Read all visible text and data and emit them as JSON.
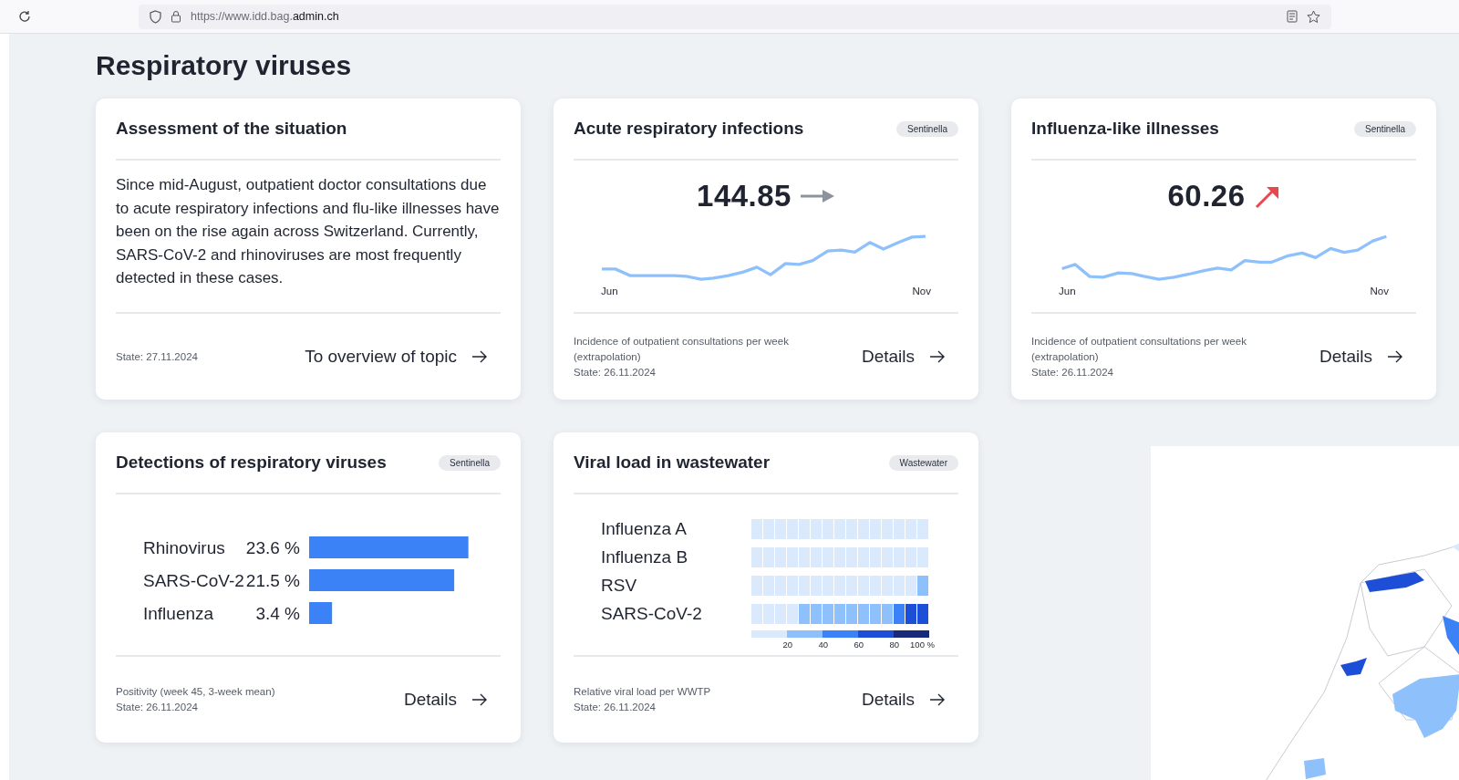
{
  "browser": {
    "url": "https://www.idd.bag.**admin.ch**"
  },
  "heading": "Respiratory viruses",
  "cards": [
    {
      "kind": "text",
      "title": "Assessment of the situation",
      "text": "Since mid-August, outpatient doctor consultations due to acute respiratory infections and flu-like illnesses have been on the rise again across Switzerland. Currently, SARS-CoV-2 and rhinoviruses are most frequently detected in these cases.",
      "state": "State: 27.11.2024",
      "link": "To overview of topic"
    },
    {
      "kind": "trend",
      "title": "Acute respiratory infections",
      "badge": "Sentinella",
      "value": "144.85",
      "trend": {
        "kind": "flat"
      },
      "start_label": "Jun",
      "end_label": "Nov",
      "note": "Incidence of outpatient consultations per week (extrapolation)",
      "state": "State: 26.11.2024",
      "link": "Details"
    },
    {
      "kind": "trend",
      "title": "Influenza-like illnesses",
      "badge": "Sentinella",
      "value": "60.26",
      "trend": {
        "kind": "up"
      },
      "start_label": "Jun",
      "end_label": "Nov",
      "note": "Incidence of outpatient consultations per week (extrapolation)",
      "state": "State: 26.11.2024",
      "link": "Details"
    },
    {
      "kind": "bars",
      "title": "Detections of respiratory viruses",
      "badge": "Sentinella",
      "chart_data": {
        "type": "bar",
        "orientation": "horizontal",
        "categories": [
          "Rhinovirus",
          "SARS-CoV-2",
          "Influenza"
        ],
        "values": [
          23.6,
          21.5,
          3.4
        ],
        "value_labels": [
          "23.6 %",
          "21.5 %",
          "3.4 %"
        ]
      },
      "note": "Positivity (week 45, 3-week mean)",
      "state": "State: 26.11.2024",
      "link": "Details"
    },
    {
      "kind": "heatmap",
      "title": "Viral load in wastewater",
      "badge": "Wastewater",
      "rows": [
        {
          "name": "Influenza A",
          "cells": [
            {
              "color": "#dbe9fd"
            },
            {
              "color": "#dbe9fd"
            },
            {
              "color": "#dbe9fd"
            },
            {
              "color": "#dbe9fd"
            },
            {
              "color": "#dbe9fd"
            },
            {
              "color": "#dbe9fd"
            },
            {
              "color": "#dbe9fd"
            },
            {
              "color": "#dbe9fd"
            },
            {
              "color": "#dbe9fd"
            },
            {
              "color": "#dbe9fd"
            },
            {
              "color": "#dbe9fd"
            },
            {
              "color": "#dbe9fd"
            },
            {
              "color": "#dbe9fd"
            },
            {
              "color": "#dbe9fd"
            },
            {
              "color": "#dbe9fd"
            }
          ]
        },
        {
          "name": "Influenza B",
          "cells": [
            {
              "color": "#dbe9fd"
            },
            {
              "color": "#dbe9fd"
            },
            {
              "color": "#dbe9fd"
            },
            {
              "color": "#dbe9fd"
            },
            {
              "color": "#dbe9fd"
            },
            {
              "color": "#dbe9fd"
            },
            {
              "color": "#dbe9fd"
            },
            {
              "color": "#dbe9fd"
            },
            {
              "color": "#dbe9fd"
            },
            {
              "color": "#dbe9fd"
            },
            {
              "color": "#dbe9fd"
            },
            {
              "color": "#dbe9fd"
            },
            {
              "color": "#dbe9fd"
            },
            {
              "color": "#dbe9fd"
            },
            {
              "color": "#dbe9fd"
            }
          ]
        },
        {
          "name": "RSV",
          "cells": [
            {
              "color": "#dbe9fd"
            },
            {
              "color": "#dbe9fd"
            },
            {
              "color": "#dbe9fd"
            },
            {
              "color": "#dbe9fd"
            },
            {
              "color": "#dbe9fd"
            },
            {
              "color": "#dbe9fd"
            },
            {
              "color": "#dbe9fd"
            },
            {
              "color": "#dbe9fd"
            },
            {
              "color": "#dbe9fd"
            },
            {
              "color": "#dbe9fd"
            },
            {
              "color": "#dbe9fd"
            },
            {
              "color": "#dbe9fd"
            },
            {
              "color": "#dbe9fd"
            },
            {
              "color": "#dbe9fd"
            },
            {
              "color": "#8ec1fb"
            }
          ]
        },
        {
          "name": "SARS-CoV-2",
          "cells": [
            {
              "color": "#dbe9fd"
            },
            {
              "color": "#dbe9fd"
            },
            {
              "color": "#dbe9fd"
            },
            {
              "color": "#dbe9fd"
            },
            {
              "color": "#8ec1fb"
            },
            {
              "color": "#8ec1fb"
            },
            {
              "color": "#8ec1fb"
            },
            {
              "color": "#8ec1fb"
            },
            {
              "color": "#8ec1fb"
            },
            {
              "color": "#8ec1fb"
            },
            {
              "color": "#8ec1fb"
            },
            {
              "color": "#8ec1fb"
            },
            {
              "color": "#3b82f6"
            },
            {
              "color": "#1d4ed8"
            },
            {
              "color": "#1d4ed8"
            }
          ]
        }
      ],
      "legend_ticks": [
        "20",
        "40",
        "60",
        "80",
        "100 %"
      ],
      "note": "Relative viral load per WWTP",
      "state": "State: 26.11.2024",
      "link": "Details"
    }
  ]
}
